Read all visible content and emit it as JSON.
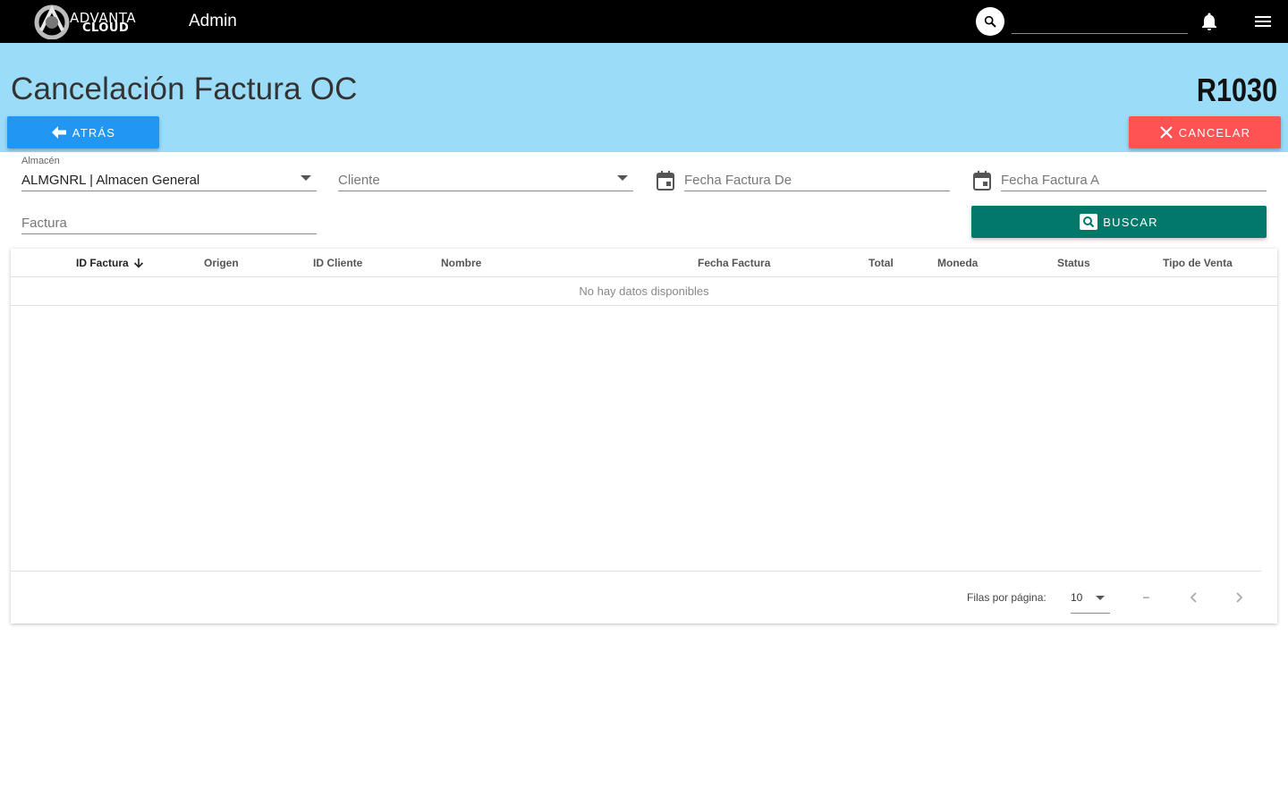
{
  "topbar": {
    "logo_line1": "ADVANTA",
    "logo_line2": "CLOUD",
    "title": "Admin",
    "search_value": ""
  },
  "header": {
    "title": "Cancelación Factura OC",
    "code": "R1030",
    "back_label": "ATRÁS",
    "cancel_label": "CANCELAR"
  },
  "filters": {
    "almacen": {
      "label": "Almacén",
      "value": "ALMGNRL | Almacen General"
    },
    "cliente": {
      "placeholder": "Cliente"
    },
    "fecha_de": {
      "placeholder": "Fecha Factura De"
    },
    "fecha_a": {
      "placeholder": "Fecha Factura A"
    },
    "factura": {
      "placeholder": "Factura"
    },
    "search_label": "BUSCAR"
  },
  "table": {
    "columns": [
      "ID Factura",
      "Origen",
      "ID Cliente",
      "Nombre",
      "Fecha Factura",
      "Total",
      "Moneda",
      "Status",
      "Tipo de Venta"
    ],
    "empty_text": "No hay datos disponibles",
    "rows_per_page_label": "Filas por página:",
    "rows_per_page_value": "10",
    "range_text": "–"
  },
  "colors": {
    "topbar": "#000000",
    "band": "#9bdcf8",
    "back_button": "#2196f3",
    "cancel_button": "#ff5252",
    "search_button": "#00796b"
  },
  "icons": [
    "search-icon",
    "bell-icon",
    "menu-icon",
    "arrow-left-icon",
    "close-icon",
    "calendar-icon",
    "magnify-icon",
    "arrow-down-icon",
    "chevron-left-icon",
    "chevron-right-icon"
  ]
}
